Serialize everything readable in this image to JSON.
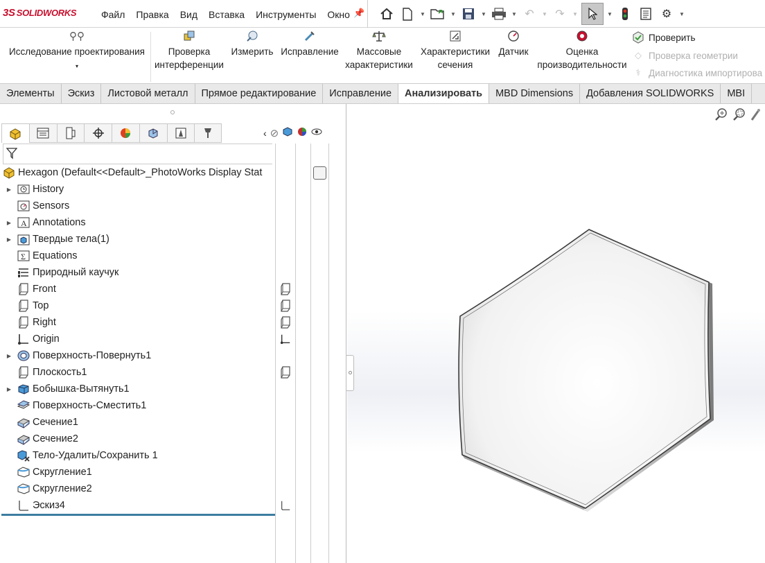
{
  "app": {
    "logo_ds": "3S",
    "logo_text": "SOLIDWORKS"
  },
  "menu": [
    "Файл",
    "Правка",
    "Вид",
    "Вставка",
    "Инструменты",
    "Окно"
  ],
  "ribbon": {
    "design_study": "Исследование проектирования",
    "interference": [
      "Проверка",
      "интерференции"
    ],
    "measure": "Измерить",
    "repair": "Исправление",
    "mass": [
      "Массовые",
      "характеристики"
    ],
    "section": [
      "Характеристики",
      "сечения"
    ],
    "sensor": "Датчик",
    "performance": [
      "Оценка",
      "производительности"
    ],
    "check": "Проверить",
    "geometry_check": "Проверка геометрии",
    "import_diag": "Диагностика импортирова"
  },
  "tabs": [
    "Элементы",
    "Эскиз",
    "Листовой металл",
    "Прямое редактирование",
    "Исправление",
    "Анализировать",
    "MBD Dimensions",
    "Добавления SOLIDWORKS",
    "MBI"
  ],
  "active_tab": "Анализировать",
  "tree": {
    "root": "Hexagon  (Default<<Default>_PhotoWorks Display Stat",
    "items": [
      {
        "label": "History",
        "expandable": true,
        "icon": "history-icon"
      },
      {
        "label": "Sensors",
        "expandable": false,
        "icon": "sensors-icon"
      },
      {
        "label": "Annotations",
        "expandable": true,
        "icon": "annotations-icon"
      },
      {
        "label": "Твердые тела(1)",
        "expandable": true,
        "icon": "solid-bodies-icon"
      },
      {
        "label": "Equations",
        "expandable": false,
        "icon": "equations-icon"
      },
      {
        "label": "Природный каучук",
        "expandable": false,
        "icon": "material-icon"
      },
      {
        "label": "Front",
        "expandable": false,
        "icon": "plane-icon"
      },
      {
        "label": "Top",
        "expandable": false,
        "icon": "plane-icon"
      },
      {
        "label": "Right",
        "expandable": false,
        "icon": "plane-icon"
      },
      {
        "label": "Origin",
        "expandable": false,
        "icon": "origin-icon"
      },
      {
        "label": "Поверхность-Повернуть1",
        "expandable": true,
        "icon": "revolve-surface-icon"
      },
      {
        "label": "Плоскость1",
        "expandable": false,
        "icon": "plane-icon"
      },
      {
        "label": "Бобышка-Вытянуть1",
        "expandable": true,
        "icon": "extrude-icon"
      },
      {
        "label": "Поверхность-Сместить1",
        "expandable": false,
        "icon": "offset-surface-icon"
      },
      {
        "label": "Сечение1",
        "expandable": false,
        "icon": "section-icon"
      },
      {
        "label": "Сечение2",
        "expandable": false,
        "icon": "section-icon"
      },
      {
        "label": "Тело-Удалить/Сохранить 1",
        "expandable": false,
        "icon": "delete-body-icon"
      },
      {
        "label": "Скругление1",
        "expandable": false,
        "icon": "fillet-icon"
      },
      {
        "label": "Скругление2",
        "expandable": false,
        "icon": "fillet-icon"
      },
      {
        "label": "Эскиз4",
        "expandable": false,
        "icon": "sketch-icon"
      }
    ]
  },
  "colors": {
    "accent": "#c8102e",
    "rollback_bar": "#3c7ea0",
    "tab_bar": "#e9e9e9"
  }
}
